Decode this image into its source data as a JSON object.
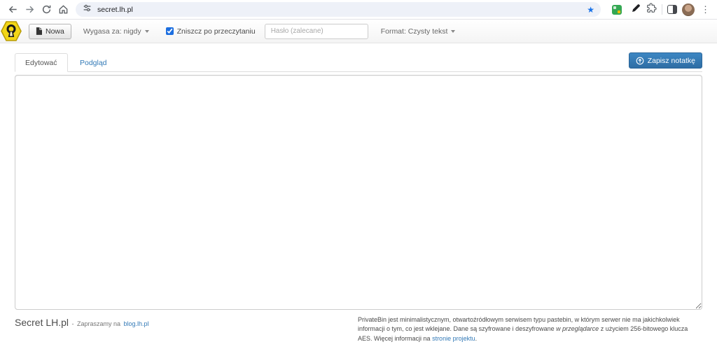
{
  "browser": {
    "url": "secret.lh.pl",
    "icons": [
      "back-arrow",
      "forward-arrow",
      "reload",
      "home",
      "tune",
      "bookmark-star",
      "green-extension",
      "pen",
      "extensions-puzzle",
      "side-panel",
      "avatar",
      "kebab-menu"
    ],
    "kebab_glyph": "⋮",
    "star_glyph": "★"
  },
  "toolbar": {
    "new_label": "Nowa",
    "expires_label": "Wygasa za: nigdy",
    "burn_label": "Zniszcz po przeczytaniu",
    "burn_checked": true,
    "password_placeholder": "Hasło (zalecane)",
    "format_label": "Format: Czysty tekst"
  },
  "editor": {
    "tab_edit": "Edytować",
    "tab_preview": "Podgląd",
    "send_label": "Zapisz notatkę",
    "content": ""
  },
  "footer": {
    "brand": "Secret LH.pl",
    "separator": "-",
    "tagline_text": "Zapraszamy na",
    "tagline_link": "blog.lh.pl",
    "about_1": "PrivateBin jest minimalistycznym, otwartoźródłowym serwisem typu pastebin, w którym serwer nie ma jakichkolwiek informacji o tym, co jest wklejane. Dane są szyfrowane i deszyfrowane",
    "about_italic": "w przeglądarce",
    "about_2": "z użyciem 256-bitowego klucza AES. Więcej informacji na",
    "about_link": "stronie projektu",
    "about_period": "."
  },
  "colors": {
    "accent_blue": "#337ab7",
    "primary_button_top": "#3d87c3",
    "primary_button_bottom": "#2e6da4",
    "logo_yellow": "#f3d616",
    "star_blue": "#1a73e8",
    "checkbox_blue": "#1d6fe0",
    "navbar_bg": "#f4f4f4",
    "omnibox_bg": "#eef1f8"
  }
}
